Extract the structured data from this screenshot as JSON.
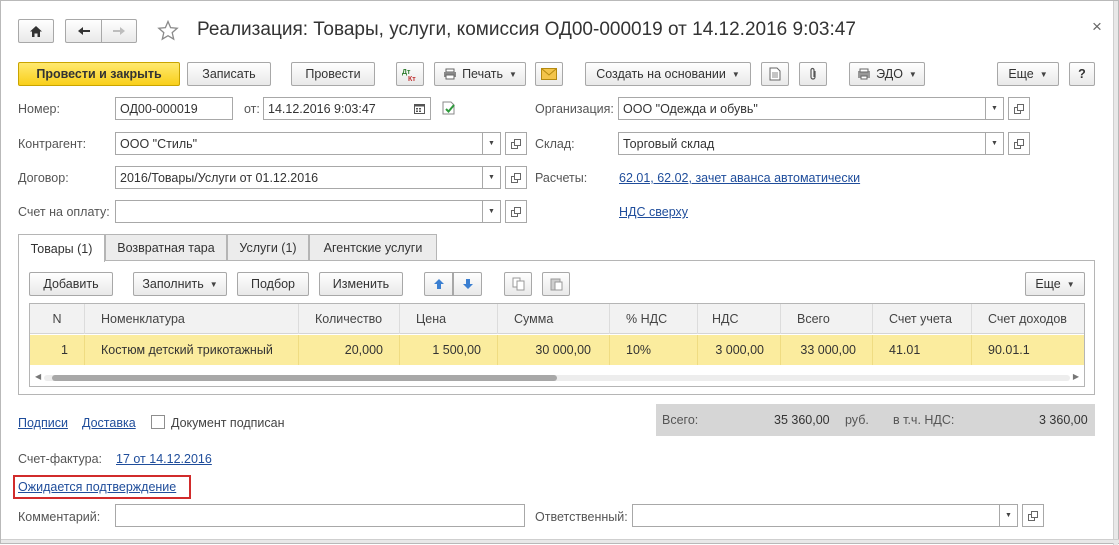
{
  "window": {
    "title": "Реализация: Товары, услуги, комиссия ОД00-000019 от 14.12.2016 9:03:47",
    "close_glyph": "×",
    "home_icon": "home-icon",
    "back_icon": "arrow-left-icon",
    "forward_icon": "arrow-right-icon",
    "star_icon": "star-icon"
  },
  "toolbar": {
    "post_and_close": "Провести и закрыть",
    "save": "Записать",
    "post": "Провести",
    "print": "Печать",
    "create_based_on": "Создать на основании",
    "edo": "ЭДО",
    "more": "Еще",
    "help": "?"
  },
  "header": {
    "number_label": "Номер:",
    "number_value": "ОД00-000019",
    "date_label": "от:",
    "date_value": "14.12.2016  9:03:47",
    "org_label": "Организация:",
    "org_value": "ООО \"Одежда и обувь\"",
    "counterparty_label": "Контрагент:",
    "counterparty_value": "ООО \"Стиль\"",
    "warehouse_label": "Склад:",
    "warehouse_value": "Торговый склад",
    "contract_label": "Договор:",
    "contract_value": "2016/Товары/Услуги от 01.12.2016",
    "settlements_label": "Расчеты:",
    "settlements_link": "62.01, 62.02, зачет аванса автоматически",
    "invoice_label": "Счет на оплату:",
    "invoice_value": "",
    "vat_link": "НДС сверху"
  },
  "tabs": [
    {
      "label": "Товары (1)",
      "active": true
    },
    {
      "label": "Возвратная тара",
      "active": false
    },
    {
      "label": "Услуги (1)",
      "active": false
    },
    {
      "label": "Агентские услуги",
      "active": false
    }
  ],
  "table_toolbar": {
    "add": "Добавить",
    "fill": "Заполнить",
    "selection": "Подбор",
    "change": "Изменить",
    "more": "Еще"
  },
  "table": {
    "columns": [
      "N",
      "Номенклатура",
      "Количество",
      "Цена",
      "Сумма",
      "% НДС",
      "НДС",
      "Всего",
      "Счет учета",
      "Счет доходов"
    ],
    "rows": [
      [
        "1",
        "Костюм детский трикотажный",
        "20,000",
        "1 500,00",
        "30 000,00",
        "10%",
        "3 000,00",
        "33 000,00",
        "41.01",
        "90.01.1"
      ]
    ],
    "horizontal_scroll_fraction": 0.5
  },
  "footer": {
    "signatures_link": "Подписи",
    "delivery_link": "Доставка",
    "signed_checkbox_label": "Документ подписан",
    "signed_checked": false,
    "total_label": "Всего:",
    "total_value": "35 360,00",
    "currency": "руб.",
    "vat_incl_label": "в т.ч. НДС:",
    "vat_value": "3 360,00",
    "invoice_doc_label": "Счет-фактура:",
    "invoice_doc_link": "17 от 14.12.2016",
    "awaiting_link": "Ожидается подтверждение",
    "comment_label": "Комментарий:",
    "comment_value": "",
    "responsible_label": "Ответственный:",
    "responsible_value": ""
  },
  "colors": {
    "primary_button": "#f9cf1a",
    "selected_row": "#fbec9e",
    "link": "#1f4d9b",
    "highlight_border": "#d12b2b"
  }
}
